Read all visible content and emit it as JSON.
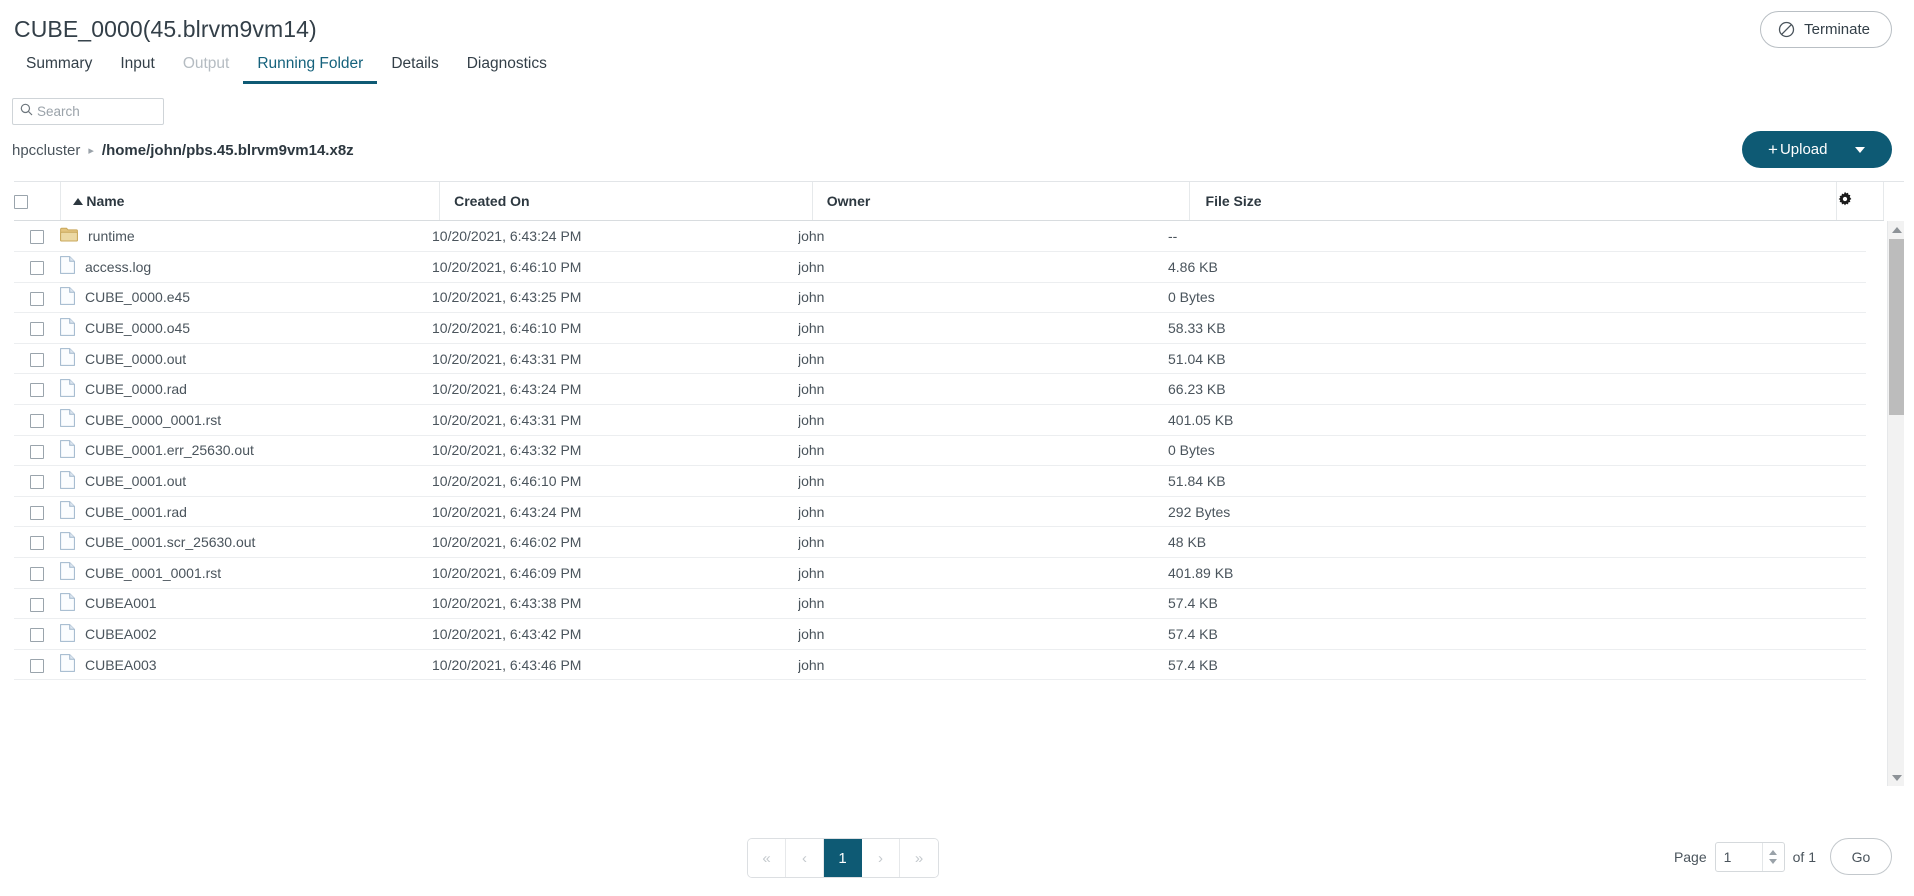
{
  "header": {
    "title": "CUBE_0000(45.blrvm9vm14)",
    "terminate_label": "Terminate",
    "terminate_icon": "no-entry-icon"
  },
  "tabs": [
    {
      "label": "Summary",
      "state": "normal"
    },
    {
      "label": "Input",
      "state": "normal"
    },
    {
      "label": "Output",
      "state": "disabled"
    },
    {
      "label": "Running Folder",
      "state": "active"
    },
    {
      "label": "Details",
      "state": "normal"
    },
    {
      "label": "Diagnostics",
      "state": "normal"
    }
  ],
  "search": {
    "value": "",
    "placeholder": "Search",
    "icon": "search-icon"
  },
  "breadcrumb": {
    "root": "hpccluster",
    "separator": "▸",
    "path": "/home/john/pbs.45.blrvm9vm14.x8z"
  },
  "upload": {
    "plus": "+",
    "label": "Upload",
    "caret_icon": "chevron-down-icon"
  },
  "table": {
    "columns": [
      {
        "key": "name",
        "label": "Name",
        "sorted": "asc"
      },
      {
        "key": "created",
        "label": "Created On"
      },
      {
        "key": "owner",
        "label": "Owner"
      },
      {
        "key": "size",
        "label": "File Size"
      }
    ],
    "settings_icon": "gear-icon",
    "rows": [
      {
        "icon": "folder-icon",
        "name": "runtime",
        "created": "10/20/2021, 6:43:24 PM",
        "owner": "john",
        "size": "--"
      },
      {
        "icon": "file-icon",
        "name": "access.log",
        "created": "10/20/2021, 6:46:10 PM",
        "owner": "john",
        "size": "4.86 KB"
      },
      {
        "icon": "file-icon",
        "name": "CUBE_0000.e45",
        "created": "10/20/2021, 6:43:25 PM",
        "owner": "john",
        "size": "0 Bytes"
      },
      {
        "icon": "file-icon",
        "name": "CUBE_0000.o45",
        "created": "10/20/2021, 6:46:10 PM",
        "owner": "john",
        "size": "58.33 KB"
      },
      {
        "icon": "file-icon",
        "name": "CUBE_0000.out",
        "created": "10/20/2021, 6:43:31 PM",
        "owner": "john",
        "size": "51.04 KB"
      },
      {
        "icon": "file-icon",
        "name": "CUBE_0000.rad",
        "created": "10/20/2021, 6:43:24 PM",
        "owner": "john",
        "size": "66.23 KB"
      },
      {
        "icon": "file-icon",
        "name": "CUBE_0000_0001.rst",
        "created": "10/20/2021, 6:43:31 PM",
        "owner": "john",
        "size": "401.05 KB"
      },
      {
        "icon": "file-icon",
        "name": "CUBE_0001.err_25630.out",
        "created": "10/20/2021, 6:43:32 PM",
        "owner": "john",
        "size": "0 Bytes"
      },
      {
        "icon": "file-icon",
        "name": "CUBE_0001.out",
        "created": "10/20/2021, 6:46:10 PM",
        "owner": "john",
        "size": "51.84 KB"
      },
      {
        "icon": "file-icon",
        "name": "CUBE_0001.rad",
        "created": "10/20/2021, 6:43:24 PM",
        "owner": "john",
        "size": "292 Bytes"
      },
      {
        "icon": "file-icon",
        "name": "CUBE_0001.scr_25630.out",
        "created": "10/20/2021, 6:46:02 PM",
        "owner": "john",
        "size": "48 KB"
      },
      {
        "icon": "file-icon",
        "name": "CUBE_0001_0001.rst",
        "created": "10/20/2021, 6:46:09 PM",
        "owner": "john",
        "size": "401.89 KB"
      },
      {
        "icon": "file-icon",
        "name": "CUBEA001",
        "created": "10/20/2021, 6:43:38 PM",
        "owner": "john",
        "size": "57.4 KB"
      },
      {
        "icon": "file-icon",
        "name": "CUBEA002",
        "created": "10/20/2021, 6:43:42 PM",
        "owner": "john",
        "size": "57.4 KB"
      },
      {
        "icon": "file-icon",
        "name": "CUBEA003",
        "created": "10/20/2021, 6:43:46 PM",
        "owner": "john",
        "size": "57.4 KB"
      }
    ]
  },
  "pagination": {
    "first": "«",
    "prev": "‹",
    "current_page": "1",
    "next": "›",
    "last": "»",
    "page_label": "Page",
    "page_value": "1",
    "of_label": "of 1",
    "go_label": "Go"
  },
  "colors": {
    "accent": "#0e5a74",
    "active_tab": "#15627c",
    "text": "#333f48",
    "muted": "#9aa2a9",
    "folder": "#d9b978",
    "file": "#dce6f0"
  }
}
